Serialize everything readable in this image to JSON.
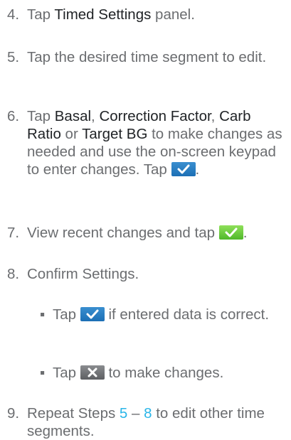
{
  "steps": [
    {
      "num": "4.",
      "pre": "Tap ",
      "bold": "Timed Settings",
      "post": " panel."
    },
    {
      "num": "5.",
      "text": "Tap the desired time segment to edit."
    },
    {
      "num": "6.",
      "pre": "Tap ",
      "b1": "Basal",
      "s1": ", ",
      "b2": "Correction Factor",
      "s2": ", ",
      "b3": "Carb Ratio",
      "s3": " or ",
      "b4": "Target BG",
      "post": " to make changes as needed and use the on-screen keypad to enter changes. Tap ",
      "end": "."
    },
    {
      "num": "7.",
      "text": "View recent changes and tap ",
      "end": "."
    },
    {
      "num": "8.",
      "text": "Confirm Settings."
    },
    {
      "num": "9.",
      "pre": "Repeat Steps ",
      "link1": "5",
      "mid": " – ",
      "link2": "8",
      "post": " to edit other time segments."
    }
  ],
  "bullets": [
    {
      "dot": "▪",
      "pre": "Tap ",
      "post": " if entered data is correct."
    },
    {
      "dot": "▪",
      "pre": "Tap ",
      "post": " to make changes."
    }
  ],
  "icons": {
    "confirm": "check-icon",
    "confirm_green": "check-icon",
    "cancel": "x-icon"
  },
  "colors": {
    "text": "#6b6d70",
    "bold": "#1f2225",
    "link": "#29b5e8",
    "button_blue": "#2478c0",
    "button_green": "#6cce3e",
    "button_gray": "#6e7073"
  }
}
